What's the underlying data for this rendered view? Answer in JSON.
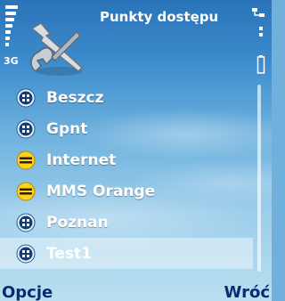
{
  "status": {
    "network_type": "3G",
    "signal_icon": "signal-strength-icon",
    "battery_icon": "battery-icon",
    "connection_icon": "connection-icon"
  },
  "header": {
    "title": "Punkty dostępu",
    "app_icon": "settings-tools-icon"
  },
  "access_points": [
    {
      "label": "Beszcz",
      "icon": "packet-data-icon",
      "icon_color": "#1e5a9a"
    },
    {
      "label": "Gpnt",
      "icon": "packet-data-icon",
      "icon_color": "#1e5a9a"
    },
    {
      "label": "Internet",
      "icon": "internet-access-icon",
      "icon_color": "#f2c200"
    },
    {
      "label": "MMS Orange",
      "icon": "internet-access-icon",
      "icon_color": "#f2c200"
    },
    {
      "label": "Poznan",
      "icon": "packet-data-icon",
      "icon_color": "#1e5a9a"
    },
    {
      "label": "Test1",
      "icon": "packet-data-icon",
      "icon_color": "#1e5a9a",
      "selected": true
    }
  ],
  "softkeys": {
    "left": "Opcje",
    "right": "Wróć"
  }
}
